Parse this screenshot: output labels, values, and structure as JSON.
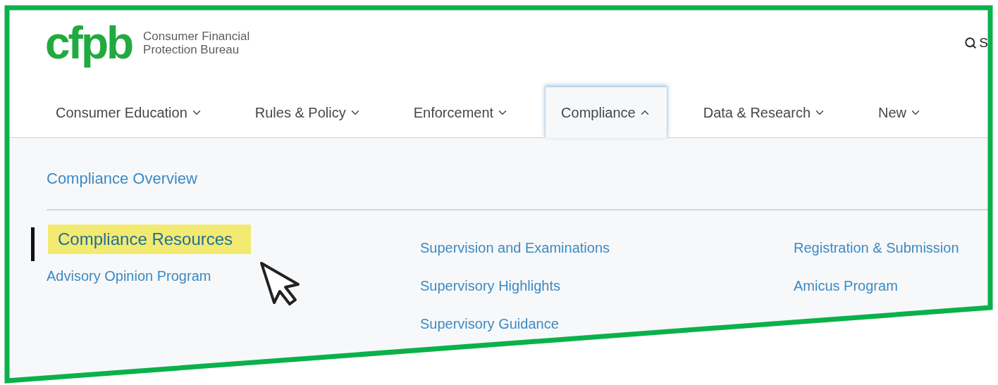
{
  "header": {
    "logo": {
      "mark": "cfpb",
      "name_lines": [
        "Consumer Financial",
        "Protection Bureau"
      ]
    },
    "search": {
      "label": "S"
    }
  },
  "nav": [
    {
      "label": "Consumer Education",
      "expanded": false,
      "selected": false
    },
    {
      "label": "Rules & Policy",
      "expanded": false,
      "selected": false
    },
    {
      "label": "Enforcement",
      "expanded": false,
      "selected": false
    },
    {
      "label": "Compliance",
      "expanded": true,
      "selected": true
    },
    {
      "label": "Data & Research",
      "expanded": false,
      "selected": false
    },
    {
      "label": "New",
      "expanded": false,
      "selected": false
    }
  ],
  "dropdown": {
    "overview": "Compliance Overview",
    "columns": [
      [
        {
          "label": "Compliance Resources",
          "highlighted": true
        },
        {
          "label": "Advisory Opinion Program",
          "highlighted": false
        }
      ],
      [
        {
          "label": "Supervision and Examinations",
          "highlighted": false
        },
        {
          "label": "Supervisory Highlights",
          "highlighted": false
        },
        {
          "label": "Supervisory Guidance",
          "highlighted": false
        }
      ],
      [
        {
          "label": "Registration & Submission",
          "highlighted": false
        },
        {
          "label": "Amicus Program",
          "highlighted": false
        }
      ]
    ]
  }
}
